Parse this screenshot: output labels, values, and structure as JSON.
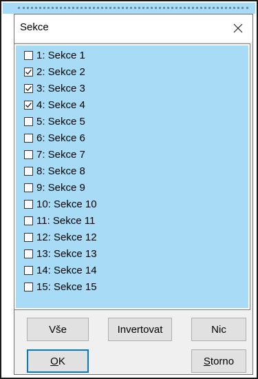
{
  "dialog": {
    "title": "Sekce",
    "close_glyph": "✕"
  },
  "list": {
    "items": [
      {
        "label": "1: Sekce 1",
        "checked": false
      },
      {
        "label": "2: Sekce 2",
        "checked": true
      },
      {
        "label": "3: Sekce 3",
        "checked": true
      },
      {
        "label": "4: Sekce 4",
        "checked": true
      },
      {
        "label": "5: Sekce 5",
        "checked": false
      },
      {
        "label": "6: Sekce 6",
        "checked": false
      },
      {
        "label": "7: Sekce 7",
        "checked": false
      },
      {
        "label": "8: Sekce 8",
        "checked": false
      },
      {
        "label": "9: Sekce 9",
        "checked": false
      },
      {
        "label": "10: Sekce 10",
        "checked": false
      },
      {
        "label": "11: Sekce 11",
        "checked": false
      },
      {
        "label": "12: Sekce 12",
        "checked": false
      },
      {
        "label": "13: Sekce 13",
        "checked": false
      },
      {
        "label": "14: Sekce 14",
        "checked": false
      },
      {
        "label": "15: Sekce 15",
        "checked": false
      }
    ],
    "background": "#a8dcf6"
  },
  "buttons": {
    "all": "Vše",
    "invert": "Invertovat",
    "none": "Nic",
    "ok_mnemonic": "O",
    "ok_rest": "K",
    "cancel_mnemonic": "S",
    "cancel_rest": "torno"
  },
  "colors": {
    "default_button_border": "#0078d7",
    "dialog_background": "#f0f0f0"
  }
}
